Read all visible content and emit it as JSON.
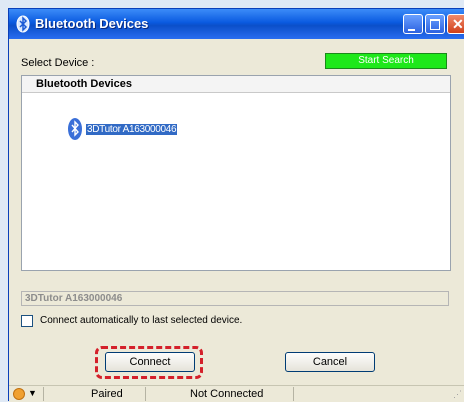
{
  "window": {
    "title": "Bluetooth Devices"
  },
  "select_label": "Select Device :",
  "start_search_label": "Start Search",
  "device_list": {
    "header": "Bluetooth Devices",
    "items": [
      {
        "name": "3DTutor A163000046"
      }
    ]
  },
  "selected_device_value": "3DTutor A163000046",
  "auto_connect_label": "Connect automatically to last selected device.",
  "buttons": {
    "connect": "Connect",
    "cancel": "Cancel"
  },
  "status": {
    "paired": "Paired",
    "connection": "Not Connected"
  },
  "colors": {
    "title_bar": "#0a5ae0",
    "start_search_bg": "#1ee81a",
    "selection": "#316ac5",
    "highlight_ring": "#d4202a"
  }
}
